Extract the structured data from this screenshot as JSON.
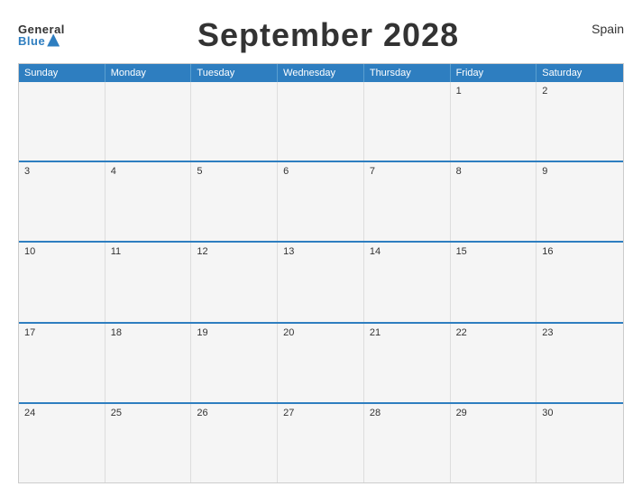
{
  "header": {
    "logo_general": "General",
    "logo_blue": "Blue",
    "title": "September 2028",
    "country": "Spain"
  },
  "calendar": {
    "days": [
      "Sunday",
      "Monday",
      "Tuesday",
      "Wednesday",
      "Thursday",
      "Friday",
      "Saturday"
    ],
    "weeks": [
      [
        {
          "day": "",
          "empty": true
        },
        {
          "day": "",
          "empty": true
        },
        {
          "day": "",
          "empty": true
        },
        {
          "day": "",
          "empty": true
        },
        {
          "day": "",
          "empty": true
        },
        {
          "day": "1",
          "empty": false
        },
        {
          "day": "2",
          "empty": false
        }
      ],
      [
        {
          "day": "3",
          "empty": false
        },
        {
          "day": "4",
          "empty": false
        },
        {
          "day": "5",
          "empty": false
        },
        {
          "day": "6",
          "empty": false
        },
        {
          "day": "7",
          "empty": false
        },
        {
          "day": "8",
          "empty": false
        },
        {
          "day": "9",
          "empty": false
        }
      ],
      [
        {
          "day": "10",
          "empty": false
        },
        {
          "day": "11",
          "empty": false
        },
        {
          "day": "12",
          "empty": false
        },
        {
          "day": "13",
          "empty": false
        },
        {
          "day": "14",
          "empty": false
        },
        {
          "day": "15",
          "empty": false
        },
        {
          "day": "16",
          "empty": false
        }
      ],
      [
        {
          "day": "17",
          "empty": false
        },
        {
          "day": "18",
          "empty": false
        },
        {
          "day": "19",
          "empty": false
        },
        {
          "day": "20",
          "empty": false
        },
        {
          "day": "21",
          "empty": false
        },
        {
          "day": "22",
          "empty": false
        },
        {
          "day": "23",
          "empty": false
        }
      ],
      [
        {
          "day": "24",
          "empty": false
        },
        {
          "day": "25",
          "empty": false
        },
        {
          "day": "26",
          "empty": false
        },
        {
          "day": "27",
          "empty": false
        },
        {
          "day": "28",
          "empty": false
        },
        {
          "day": "29",
          "empty": false
        },
        {
          "day": "30",
          "empty": false
        }
      ]
    ]
  }
}
